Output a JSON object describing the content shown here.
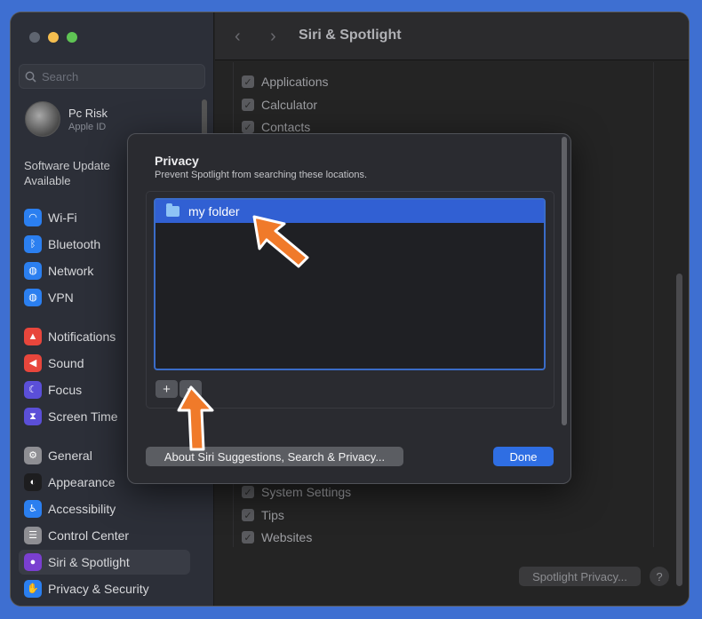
{
  "window": {
    "title": "Siri & Spotlight"
  },
  "sidebar": {
    "search_placeholder": "Search",
    "profile": {
      "name": "Pc Risk",
      "subtitle": "Apple ID"
    },
    "software_update": "Software Update Available",
    "items": [
      {
        "label": "Wi-Fi",
        "icon": "wifi-icon",
        "color": "#2b7ff0"
      },
      {
        "label": "Bluetooth",
        "icon": "bluetooth-icon",
        "color": "#2b7ff0"
      },
      {
        "label": "Network",
        "icon": "globe-icon",
        "color": "#2b7ff0"
      },
      {
        "label": "VPN",
        "icon": "vpn-globe-icon",
        "color": "#2b7ff0"
      },
      {
        "label": "Notifications",
        "icon": "bell-icon",
        "color": "#e8463c"
      },
      {
        "label": "Sound",
        "icon": "speaker-icon",
        "color": "#e8463c"
      },
      {
        "label": "Focus",
        "icon": "moon-icon",
        "color": "#5b4fd8"
      },
      {
        "label": "Screen Time",
        "icon": "hourglass-icon",
        "color": "#5b4fd8"
      },
      {
        "label": "General",
        "icon": "gear-icon",
        "color": "#8e8e93"
      },
      {
        "label": "Appearance",
        "icon": "appearance-icon",
        "color": "#1d1d1f"
      },
      {
        "label": "Accessibility",
        "icon": "accessibility-icon",
        "color": "#2b7ff0"
      },
      {
        "label": "Control Center",
        "icon": "control-center-icon",
        "color": "#8e8e93"
      },
      {
        "label": "Siri & Spotlight",
        "icon": "siri-icon",
        "color": "#7a3fd0"
      },
      {
        "label": "Privacy & Security",
        "icon": "hand-icon",
        "color": "#2b7ff0"
      }
    ]
  },
  "main": {
    "checkbox_items_top": [
      "Applications",
      "Calculator",
      "Contacts"
    ],
    "checkbox_items_bottom": [
      "System Settings",
      "Tips",
      "Websites"
    ],
    "spotlight_privacy_button": "Spotlight Privacy...",
    "help_button": "?"
  },
  "dialog": {
    "title": "Privacy",
    "subtitle": "Prevent Spotlight from searching these locations.",
    "folders": [
      "my folder"
    ],
    "add_button": "+",
    "remove_button": "−",
    "about_button": "About Siri Suggestions, Search & Privacy...",
    "done_button": "Done"
  },
  "colors": {
    "accent": "#2f6ee3",
    "selection": "#3160d3",
    "annotation_arrow": "#f07a2a"
  }
}
